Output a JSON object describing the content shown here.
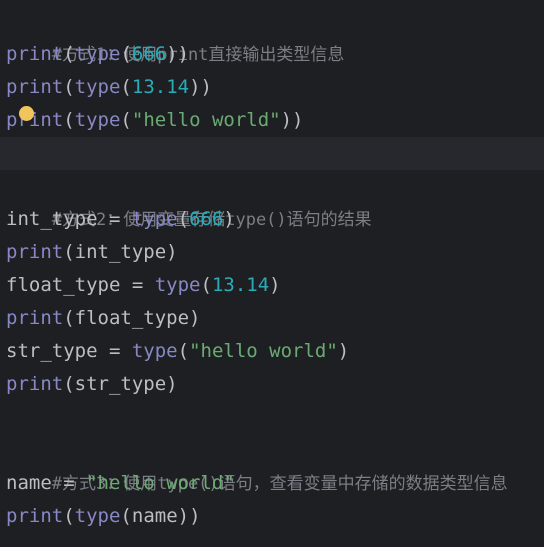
{
  "editor": {
    "lines": [
      {
        "comment": "#方式1：使用print直接输出类型信息"
      },
      {
        "fn": "print",
        "open": "(",
        "inner_fn": "type",
        "inner_open": "(",
        "num": "666",
        "close": "))"
      },
      {
        "fn": "print",
        "open": "(",
        "inner_fn": "type",
        "inner_open": "(",
        "num": "13.14",
        "close": "))"
      },
      {
        "fn": "print",
        "open": "(",
        "inner_fn": "type",
        "inner_open": "(",
        "str": "\"hello world\"",
        "close": "))"
      },
      {
        "empty": ""
      },
      {
        "comment": "#方式2：使用变量存储type()语句的结果"
      },
      {
        "var": "int_type",
        "eq": " = ",
        "fn": "type",
        "open": "(",
        "num": "666",
        "close": ")"
      },
      {
        "fn": "print",
        "open": "(",
        "arg": "int_type",
        "close": ")"
      },
      {
        "var": "float_type",
        "eq": " = ",
        "fn": "type",
        "open": "(",
        "num": "13.14",
        "close": ")"
      },
      {
        "fn": "print",
        "open": "(",
        "arg": "float_type",
        "close": ")"
      },
      {
        "var": "str_type",
        "eq": " = ",
        "fn": "type",
        "open": "(",
        "str": "\"hello world\"",
        "close": ")"
      },
      {
        "fn": "print",
        "open": "(",
        "arg": "str_type",
        "close": ")"
      },
      {
        "empty": ""
      },
      {
        "comment": "#方式3：使用type()语句，查看变量中存储的数据类型信息"
      },
      {
        "var": "name",
        "eq": " = ",
        "str": "\"hello world\""
      },
      {
        "fn": "print",
        "open": "(",
        "inner_fn": "type",
        "inner_open": "(",
        "arg": "name",
        "close": "))"
      }
    ]
  },
  "colors": {
    "background": "#1e1f22",
    "current_line": "#26282e",
    "comment": "#7a7e85",
    "builtin": "#8888c6",
    "number": "#2aacb8",
    "string": "#6aab73",
    "text": "#bcbec4",
    "bulb": "#f2c55c"
  },
  "icons": {
    "intention": "lightbulb-icon"
  }
}
